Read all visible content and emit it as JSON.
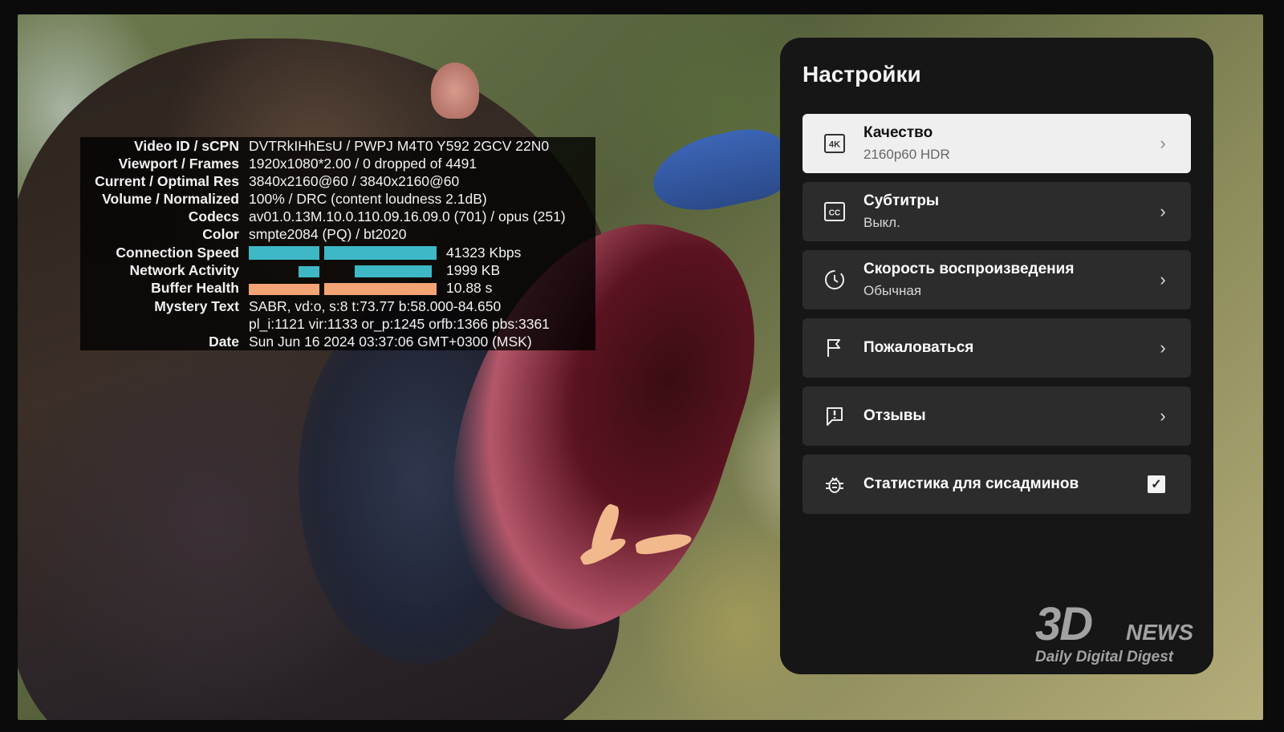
{
  "stats": {
    "rows": [
      {
        "label": "Video ID / sCPN",
        "value": "DVTRkIHhEsU / PWPJ M4T0 Y592 2GCV 22N0"
      },
      {
        "label": "Viewport / Frames",
        "value": "1920x1080*2.00 / 0 dropped of 4491"
      },
      {
        "label": "Current / Optimal Res",
        "value": "3840x2160@60 / 3840x2160@60"
      },
      {
        "label": "Volume / Normalized",
        "value": "100% / DRC (content loudness 2.1dB)"
      },
      {
        "label": "Codecs",
        "value": "av01.0.13M.10.0.110.09.16.09.0 (701) / opus (251)"
      },
      {
        "label": "Color",
        "value": "smpte2084 (PQ) / bt2020"
      },
      {
        "label": "Connection Speed",
        "value": "41323 Kbps"
      },
      {
        "label": "Network Activity",
        "value": "1999 KB"
      },
      {
        "label": "Buffer Health",
        "value": "10.88 s"
      },
      {
        "label": "Mystery Text",
        "value": "SABR, vd:o, s:8 t:73.77 b:58.000-84.650"
      },
      {
        "label": "",
        "value": "pl_i:1121 vir:1133 or_p:1245 orfb:1366 pbs:3361"
      },
      {
        "label": "Date",
        "value": "Sun Jun 16 2024 03:37:06 GMT+0300 (MSK)"
      }
    ],
    "colors": {
      "connection": "#3fb8c6",
      "network": "#3fb8c6",
      "buffer": "#f4a375"
    }
  },
  "settings": {
    "title": "Настройки",
    "items": [
      {
        "icon": "4k-icon",
        "glyph": "4K",
        "label": "Качество",
        "value": "2160p60 HDR",
        "selected": true
      },
      {
        "icon": "subtitles-icon",
        "glyph": "CC",
        "label": "Субтитры",
        "value": "Выкл."
      },
      {
        "icon": "playback-speed-icon",
        "glyph": "",
        "label": "Скорость воспроизведения",
        "value": "Обычная"
      },
      {
        "icon": "flag-icon",
        "glyph": "",
        "label": "Пожаловаться",
        "value": ""
      },
      {
        "icon": "feedback-icon",
        "glyph": "",
        "label": "Отзывы",
        "value": ""
      },
      {
        "icon": "bug-icon",
        "glyph": "",
        "label": "Статистика для сисадминов",
        "value": "",
        "checked": true
      }
    ]
  },
  "watermark": {
    "logo": "3D",
    "news": "NEWS",
    "tagline": "Daily Digital Digest"
  }
}
